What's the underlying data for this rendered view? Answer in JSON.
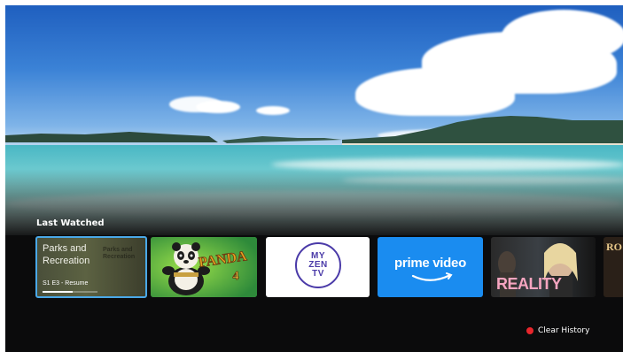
{
  "row": {
    "title": "Last Watched"
  },
  "tiles": [
    {
      "title": "Parks and Recreation",
      "ghost_title": "Parks and Recreation",
      "episode": "S1 E3 - Resume",
      "progress_fraction": 0.55,
      "focused": true,
      "accent": "#4aa8e8"
    },
    {
      "logo_text": "PANDA 4",
      "icon": "panda-art"
    },
    {
      "logo_lines": [
        "MY",
        "ZEN",
        "TV"
      ],
      "logo_color": "#4a3aa8"
    },
    {
      "logo_text": "prime video",
      "color": "#1a8cf0"
    },
    {
      "logo_text": "REALITY"
    },
    {
      "logo_text": "RO"
    }
  ],
  "clear_history": {
    "label": "Clear History",
    "icon": "red-dot-icon",
    "color": "#e8262c"
  }
}
